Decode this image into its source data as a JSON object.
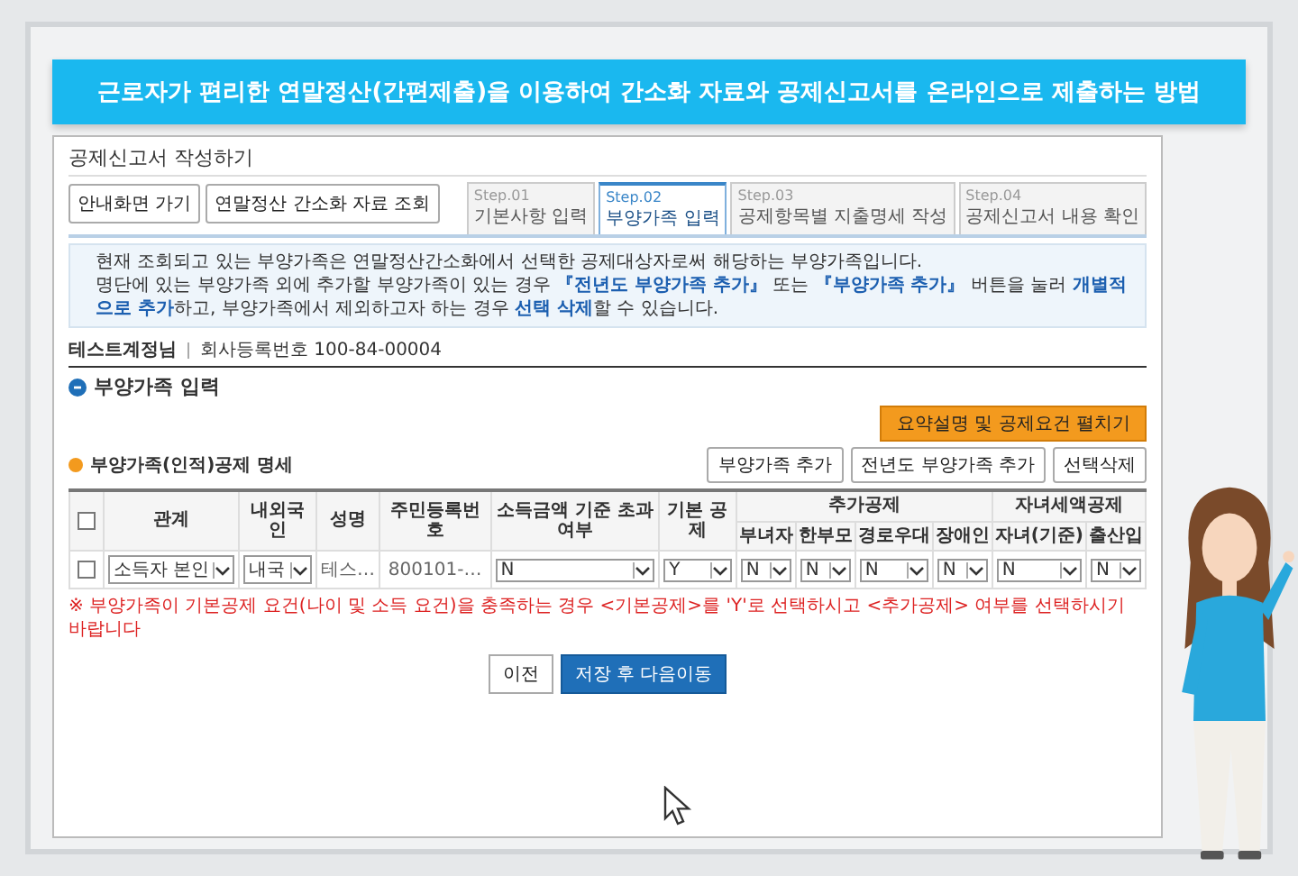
{
  "banner": {
    "title": "근로자가 편리한 연말정산(간편제출)을 이용하여 간소화 자료와 공제신고서를 온라인으로 제출하는 방법"
  },
  "page": {
    "title": "공제신고서 작성하기",
    "nav_buttons": [
      "안내화면 가기",
      "연말정산 간소화 자료 조회"
    ],
    "tabs": [
      {
        "step": "Step.01",
        "label": "기본사항 입력",
        "selected": false
      },
      {
        "step": "Step.02",
        "label": "부양가족 입력",
        "selected": true
      },
      {
        "step": "Step.03",
        "label": "공제항목별 지출명세 작성",
        "selected": false
      },
      {
        "step": "Step.04",
        "label": "공제신고서 내용 확인",
        "selected": false
      }
    ],
    "notices": [
      "현재 조회되고 있는 부양가족은 연말정산간소화에서 선택한 공제대상자로써 해당하는 부양가족입니다.",
      "명단에 있는 부양가족 외에 추가할 부양가족이 있는 경우 **『전년도 부양가족 추가』** 또는 **『부양가족 추가』** 버튼을 눌러 **개별적으로 추가**하고, 부양가족에서 제외하고자 하는 경우 **선택 삭제**할 수 있습니다."
    ],
    "account": {
      "name": "테스트계정님",
      "company": "회사등록번호 100-84-00004"
    },
    "section_title": "부양가족 입력",
    "expand_button": "요약설명 및 공제요건 펼치기",
    "table_title": "부양가족(인적)공제 명세",
    "table_buttons": [
      "부양가족 추가",
      "전년도 부양가족 추가",
      "선택삭제"
    ],
    "table": {
      "all_checked": false,
      "header_cells": [
        {
          "label": "관계"
        },
        {
          "label": "내외국인"
        },
        {
          "label": "성명"
        },
        {
          "label": "주민등록번호"
        },
        {
          "label": "소득금액 기준 초과여부"
        },
        {
          "label": "기본 공제"
        },
        {
          "label": "추가공제",
          "sub_headers": [
            {
              "label": "부녀자"
            },
            {
              "label": "한부모"
            },
            {
              "label": "경로우대"
            },
            {
              "label": "장애인"
            }
          ]
        },
        {
          "label": "자녀세액공제",
          "sub_headers": [
            {
              "label": "자녀(기준)"
            },
            {
              "label": "출산입"
            }
          ]
        }
      ],
      "rows": [
        {
          "checked": false,
          "cells": [
            {
              "kind": "select",
              "value": "소득자 본인"
            },
            {
              "kind": "select",
              "value": "내국"
            },
            {
              "kind": "text",
              "value": "테스…"
            },
            {
              "kind": "text",
              "value": "800101-…"
            },
            {
              "kind": "select",
              "value": "N"
            },
            {
              "kind": "select",
              "value": "Y"
            },
            {
              "kind": "select",
              "value": "N"
            },
            {
              "kind": "select",
              "value": "N"
            },
            {
              "kind": "select",
              "value": "N"
            },
            {
              "kind": "select",
              "value": "N"
            },
            {
              "kind": "select",
              "value": "N"
            },
            {
              "kind": "select",
              "value": "N"
            }
          ]
        }
      ]
    },
    "note": "※ 부양가족이 기본공제 요건(나이 및 소득 요건)을 충족하는 경우 <기본공제>를 'Y'로 선택하시고 <추가공제> 여부를 선택하시기 바랍니다",
    "actions": [
      {
        "kind": "secondary",
        "label": "이전"
      },
      {
        "kind": "primary",
        "label": "저장 후 다음이동"
      }
    ]
  }
}
